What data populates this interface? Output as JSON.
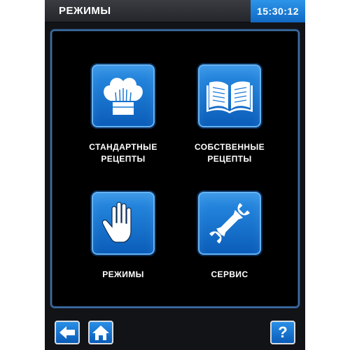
{
  "header": {
    "title": "РЕЖИМЫ",
    "time": "15:30:12"
  },
  "tiles": [
    {
      "icon": "chef-hat-icon",
      "label_lines": [
        "СТАНДАРТНЫЕ",
        "РЕЦЕПТЫ"
      ]
    },
    {
      "icon": "open-book-icon",
      "label_lines": [
        "СОБСТВЕННЫЕ",
        "РЕЦЕПТЫ"
      ]
    },
    {
      "icon": "hand-icon",
      "label_lines": [
        "РЕЖИМЫ"
      ]
    },
    {
      "icon": "wrench-icon",
      "label_lines": [
        "СЕРВИС"
      ]
    }
  ],
  "nav": {
    "back_icon": "arrow-left-icon",
    "home_icon": "home-icon",
    "help_label": "?"
  },
  "colors": {
    "accent_blue": "#1a7ad6",
    "panel_border": "#3b6fa8",
    "background": "#121317"
  }
}
